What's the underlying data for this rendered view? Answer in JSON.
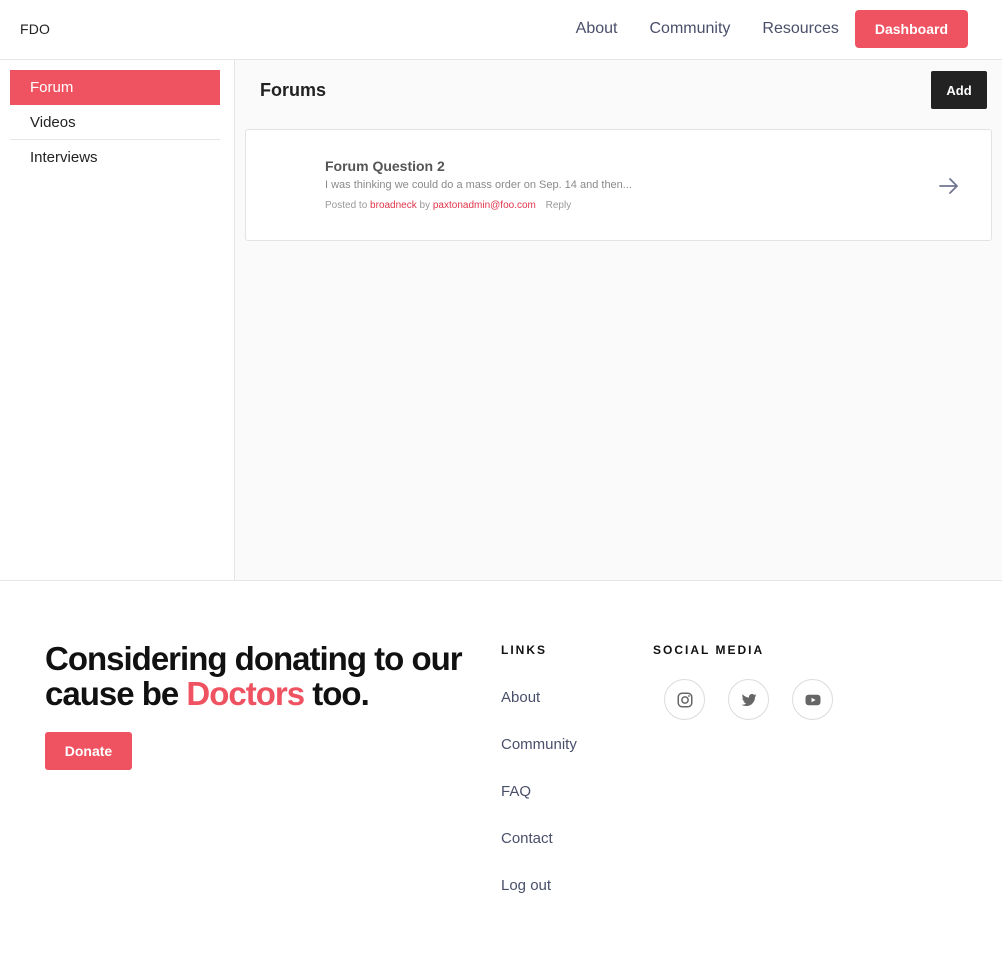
{
  "header": {
    "brand": "FDO",
    "nav": [
      "About",
      "Community",
      "Resources"
    ],
    "dashboard_label": "Dashboard"
  },
  "sidebar": {
    "items": [
      {
        "label": "Forum",
        "active": true
      },
      {
        "label": "Videos",
        "active": false
      },
      {
        "label": "Interviews",
        "active": false
      }
    ]
  },
  "main": {
    "title": "Forums",
    "add_label": "Add",
    "posts": [
      {
        "title": "Forum Question 2",
        "excerpt": "I was thinking we could do a mass order on Sep. 14 and then...",
        "posted_to_prefix": "Posted to",
        "posted_to": "broadneck",
        "by_prefix": "by",
        "author": "paxtonadmin@foo.com",
        "reply_label": "Reply"
      }
    ]
  },
  "footer": {
    "cta_part1": "Considering donating to our cause be",
    "cta_accent": "Doctors",
    "cta_part2": "too.",
    "donate_label": "Donate",
    "links_heading": "LINKS",
    "links": [
      "About",
      "Community",
      "FAQ",
      "Contact",
      "Log out"
    ],
    "social_heading": "SOCIAL MEDIA",
    "social_icons": [
      "instagram-icon",
      "twitter-icon",
      "youtube-icon"
    ]
  },
  "colors": {
    "accent": "#ef5361",
    "dark": "#222222",
    "nav_text": "#4a4f6a"
  }
}
